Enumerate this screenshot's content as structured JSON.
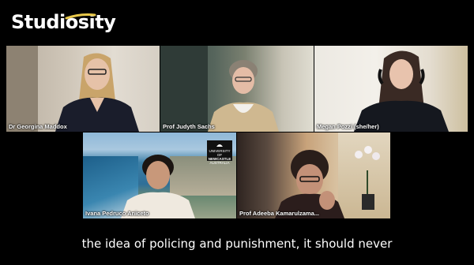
{
  "app": {
    "brand": "Studiosity"
  },
  "participants": [
    {
      "name": "Dr Georgina Maddox"
    },
    {
      "name": "Prof Judyth Sachs"
    },
    {
      "name": "Megan Pozzi (she/her)"
    },
    {
      "name": "Ivana Pedruco Aniceto"
    },
    {
      "name": "Prof Adeeba Kamarulzama..."
    }
  ],
  "background_badge": {
    "line1": "UNIVERSITY OF",
    "line2": "NEWCASTLE",
    "line3": "AUSTRALIA"
  },
  "caption": {
    "text": "the idea of policing and punishment, it should never"
  },
  "colors": {
    "brand_accent": "#e8c84a",
    "background": "#000000",
    "text": "#ffffff"
  }
}
